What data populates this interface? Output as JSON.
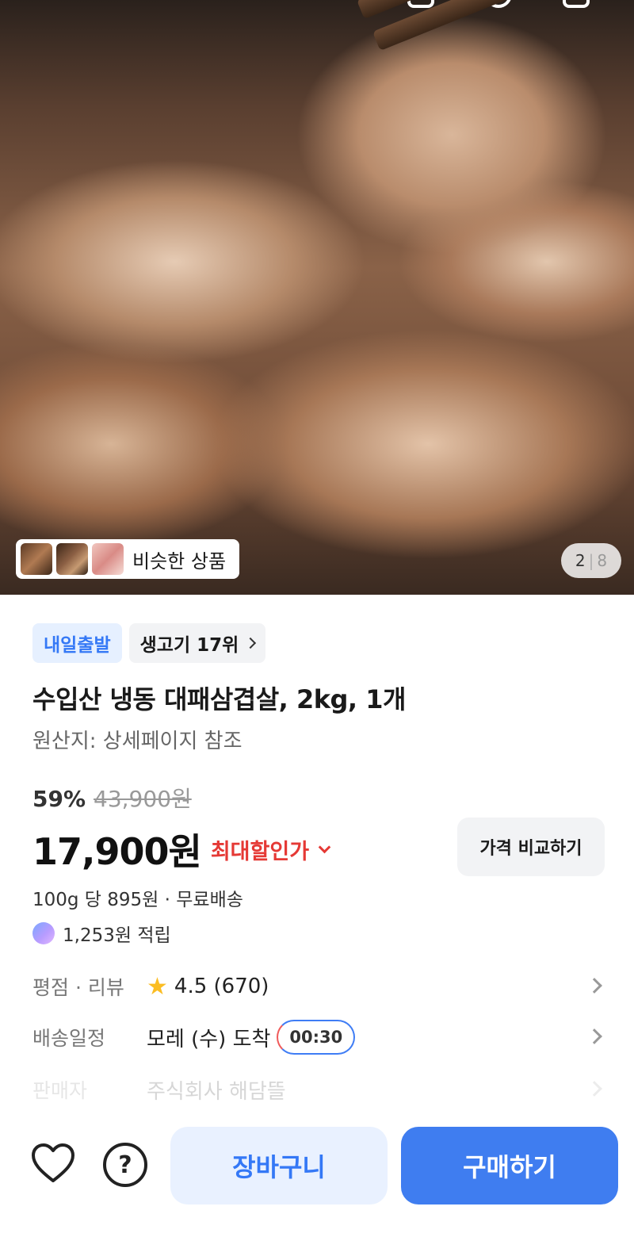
{
  "gallery": {
    "similar_label": "비슷한 상품",
    "current_index": "2",
    "separator": "|",
    "total_count": "8"
  },
  "product": {
    "badge_delivery": "내일출발",
    "badge_rank": "생고기 17위",
    "title": "수입산 냉동 대패삼겹살, 2kg, 1개",
    "origin": "원산지: 상세페이지 참조",
    "discount_rate": "59%",
    "original_price": "43,900원",
    "price": "17,900원",
    "max_discount_label": "최대할인가",
    "compare_button": "가격 비교하기",
    "unit_price": "100g 당 895원 · 무료배송",
    "points": "1,253원 적립"
  },
  "details": {
    "rating_label": "평점 · 리뷰",
    "rating_value": "4.5 (670)",
    "delivery_label": "배송일정",
    "delivery_value": "모레 (수) 도착",
    "delivery_timer": "00:30",
    "seller_label": "판매자",
    "seller_value": "주식회사 해담뜰"
  },
  "actions": {
    "cart": "장바구니",
    "buy": "구매하기"
  },
  "colors": {
    "accent_blue": "#3f7df0",
    "discount_red": "#e53935",
    "star_yellow": "#fbbd23"
  }
}
